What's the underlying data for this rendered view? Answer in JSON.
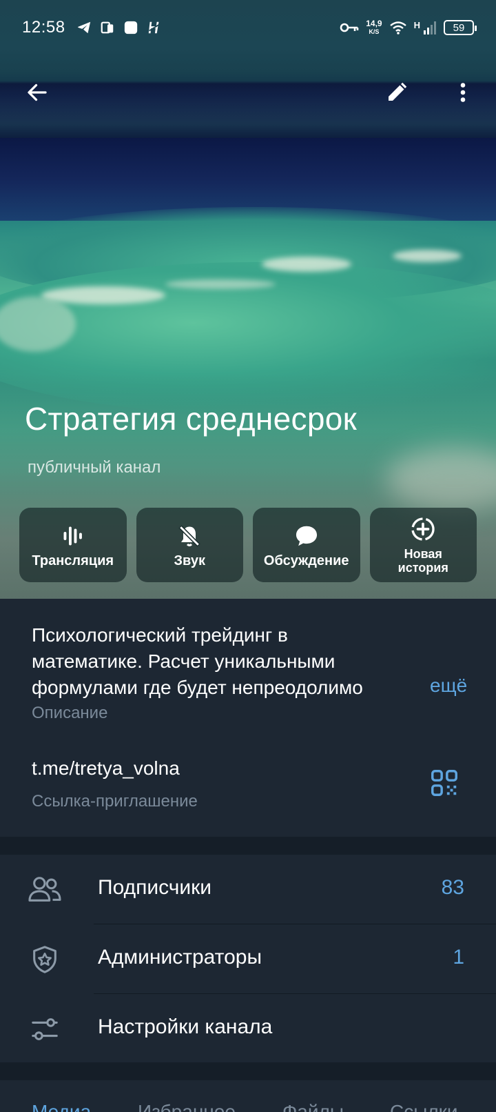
{
  "status_bar": {
    "time": "12:58",
    "net_speed_value": "14,9",
    "net_speed_unit": "K/S",
    "network_label": "H",
    "battery": "59",
    "icons": [
      "telegram-icon",
      "app-icon",
      "square-icon",
      "app-h-icon",
      "key-icon",
      "wifi-icon",
      "signal-icon",
      "battery-icon"
    ]
  },
  "toolbar": {
    "icons": [
      "back-arrow-icon",
      "pencil-icon",
      "more-vert-icon"
    ]
  },
  "channel": {
    "title": "Стратегия среднесрок",
    "subtitle": "публичный канал"
  },
  "actions": [
    {
      "label": "Трансляция",
      "icon": "live-stream-icon"
    },
    {
      "label": "Звук",
      "icon": "bell-off-icon"
    },
    {
      "label": "Обсуждение",
      "icon": "chat-bubble-icon"
    },
    {
      "label_line1": "Новая",
      "label_line2": "история",
      "icon": "add-story-icon"
    }
  ],
  "info": {
    "description_lines": [
      "Психологический трейдинг в",
      "математике. Расчет  уникальными",
      "формулами где будет непреодолимо"
    ],
    "more_label": "ещё",
    "description_caption": "Описание",
    "link": "t.me/tretya_volna",
    "link_caption": "Ссылка-приглашение"
  },
  "list": [
    {
      "label": "Подписчики",
      "value": "83",
      "icon": "people-icon"
    },
    {
      "label": "Администраторы",
      "value": "1",
      "icon": "admin-shield-icon"
    },
    {
      "label": "Настройки канала",
      "value": "",
      "icon": "settings-sliders-icon"
    }
  ],
  "tabs": [
    {
      "label": "Медиа",
      "active": true
    },
    {
      "label": "Избранное",
      "active": false
    },
    {
      "label": "Файлы",
      "active": false
    },
    {
      "label": "Ссылки",
      "active": false
    }
  ],
  "colors": {
    "background": "#1d2733",
    "section_divider": "#151e28",
    "accent": "#5ea5e0",
    "secondary_text": "#7b8a9a"
  }
}
